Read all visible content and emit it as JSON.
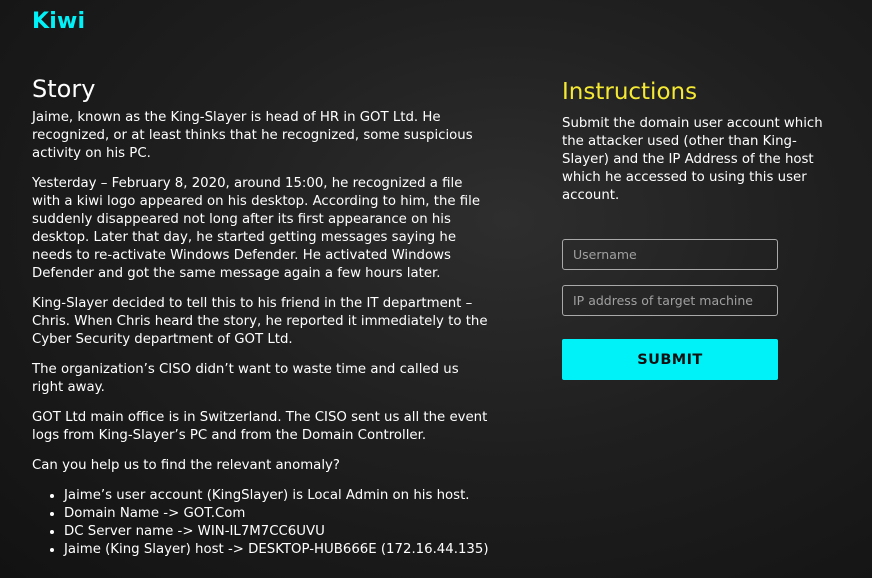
{
  "brand": {
    "logo": "Kiwi"
  },
  "story": {
    "title": "Story",
    "paragraphs": [
      "Jaime, known as the King-Slayer is head of HR in GOT Ltd. He recognized, or at least thinks that he recognized, some suspicious activity on his PC.",
      "Yesterday – February 8, 2020, around 15:00, he recognized a file with a kiwi logo appeared on his desktop. According to him, the file suddenly disappeared not long after its first appearance on his desktop. Later that day, he started getting messages saying he needs to re-activate Windows Defender. He activated Windows Defender and got the same message again a few hours later.",
      "King-Slayer decided to tell this to his friend in the IT department – Chris. When Chris heard the story, he reported it immediately to the Cyber Security department of GOT Ltd.",
      "The organization’s CISO didn’t want to waste time and called us right away.",
      "GOT Ltd main office is in Switzerland. The CISO sent us all the event logs from King-Slayer’s PC and from the Domain Controller.",
      "Can you help us to find the relevant anomaly?"
    ],
    "facts": [
      "Jaime’s user account (KingSlayer) is Local Admin on his host.",
      "Domain Name -> GOT.Com",
      "DC Server name -> WIN-IL7M7CC6UVU",
      "Jaime (King Slayer) host -> DESKTOP-HUB666E (172.16.44.135)"
    ]
  },
  "instructions": {
    "title": "Instructions",
    "text": "Submit the domain user account which the attacker used (other than King-Slayer) and the IP Address of the host which he accessed to using this user account."
  },
  "form": {
    "username_placeholder": "Username",
    "username_value": "",
    "ip_placeholder": "IP address of target machine",
    "ip_value": "",
    "submit_label": "SUBMIT"
  },
  "colors": {
    "accent_cyan": "#00f2f9",
    "accent_yellow": "#f5e934",
    "background": "#1f1f1f"
  }
}
